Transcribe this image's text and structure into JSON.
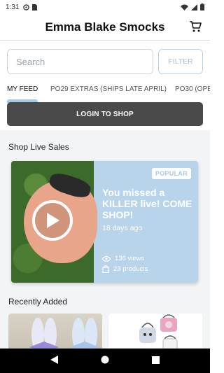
{
  "status_bar": {
    "time": "1:31",
    "left_icons": [
      "sync-icon",
      "sim-card-icon"
    ],
    "right_icons": [
      "wifi-icon",
      "signal-icon",
      "battery-icon"
    ]
  },
  "header": {
    "title": "Emma Blake Smocks",
    "cart_icon": "cart-icon"
  },
  "search": {
    "placeholder": "Search",
    "value": "",
    "filter_label": "FILTER"
  },
  "tabs": [
    {
      "label": "MY FEED",
      "active": true
    },
    {
      "label": "PO29 EXTRAS (SHIPS LATE APRIL)",
      "active": false
    },
    {
      "label": "PO30 (OPE",
      "active": false
    }
  ],
  "login_button": "LOGIN TO SHOP",
  "live_sales": {
    "section_title": "Shop Live Sales",
    "card": {
      "badge": "POPULAR",
      "headline": "You missed a KILLER live! COME SHOP!",
      "ago": "18 days ago",
      "views": "136 views",
      "products": "23 products"
    }
  },
  "recently_added": {
    "section_title": "Recently Added"
  },
  "nav_bar": [
    "back-icon",
    "home-icon",
    "recents-icon"
  ],
  "colors": {
    "accent": "#a7cbe6",
    "card_bg": "#b8d4ea",
    "login_bg": "#4a4a4a"
  }
}
